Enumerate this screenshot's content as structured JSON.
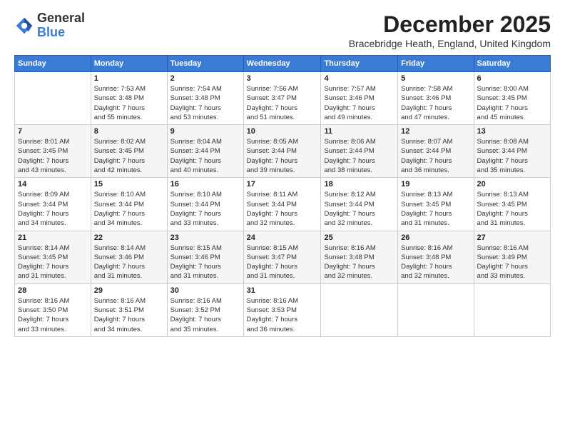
{
  "logo": {
    "general": "General",
    "blue": "Blue"
  },
  "header": {
    "month_title": "December 2025",
    "subtitle": "Bracebridge Heath, England, United Kingdom"
  },
  "days_of_week": [
    "Sunday",
    "Monday",
    "Tuesday",
    "Wednesday",
    "Thursday",
    "Friday",
    "Saturday"
  ],
  "weeks": [
    [
      {
        "day": "",
        "info": ""
      },
      {
        "day": "1",
        "info": "Sunrise: 7:53 AM\nSunset: 3:48 PM\nDaylight: 7 hours\nand 55 minutes."
      },
      {
        "day": "2",
        "info": "Sunrise: 7:54 AM\nSunset: 3:48 PM\nDaylight: 7 hours\nand 53 minutes."
      },
      {
        "day": "3",
        "info": "Sunrise: 7:56 AM\nSunset: 3:47 PM\nDaylight: 7 hours\nand 51 minutes."
      },
      {
        "day": "4",
        "info": "Sunrise: 7:57 AM\nSunset: 3:46 PM\nDaylight: 7 hours\nand 49 minutes."
      },
      {
        "day": "5",
        "info": "Sunrise: 7:58 AM\nSunset: 3:46 PM\nDaylight: 7 hours\nand 47 minutes."
      },
      {
        "day": "6",
        "info": "Sunrise: 8:00 AM\nSunset: 3:45 PM\nDaylight: 7 hours\nand 45 minutes."
      }
    ],
    [
      {
        "day": "7",
        "info": "Sunrise: 8:01 AM\nSunset: 3:45 PM\nDaylight: 7 hours\nand 43 minutes."
      },
      {
        "day": "8",
        "info": "Sunrise: 8:02 AM\nSunset: 3:45 PM\nDaylight: 7 hours\nand 42 minutes."
      },
      {
        "day": "9",
        "info": "Sunrise: 8:04 AM\nSunset: 3:44 PM\nDaylight: 7 hours\nand 40 minutes."
      },
      {
        "day": "10",
        "info": "Sunrise: 8:05 AM\nSunset: 3:44 PM\nDaylight: 7 hours\nand 39 minutes."
      },
      {
        "day": "11",
        "info": "Sunrise: 8:06 AM\nSunset: 3:44 PM\nDaylight: 7 hours\nand 38 minutes."
      },
      {
        "day": "12",
        "info": "Sunrise: 8:07 AM\nSunset: 3:44 PM\nDaylight: 7 hours\nand 36 minutes."
      },
      {
        "day": "13",
        "info": "Sunrise: 8:08 AM\nSunset: 3:44 PM\nDaylight: 7 hours\nand 35 minutes."
      }
    ],
    [
      {
        "day": "14",
        "info": "Sunrise: 8:09 AM\nSunset: 3:44 PM\nDaylight: 7 hours\nand 34 minutes."
      },
      {
        "day": "15",
        "info": "Sunrise: 8:10 AM\nSunset: 3:44 PM\nDaylight: 7 hours\nand 34 minutes."
      },
      {
        "day": "16",
        "info": "Sunrise: 8:10 AM\nSunset: 3:44 PM\nDaylight: 7 hours\nand 33 minutes."
      },
      {
        "day": "17",
        "info": "Sunrise: 8:11 AM\nSunset: 3:44 PM\nDaylight: 7 hours\nand 32 minutes."
      },
      {
        "day": "18",
        "info": "Sunrise: 8:12 AM\nSunset: 3:44 PM\nDaylight: 7 hours\nand 32 minutes."
      },
      {
        "day": "19",
        "info": "Sunrise: 8:13 AM\nSunset: 3:45 PM\nDaylight: 7 hours\nand 31 minutes."
      },
      {
        "day": "20",
        "info": "Sunrise: 8:13 AM\nSunset: 3:45 PM\nDaylight: 7 hours\nand 31 minutes."
      }
    ],
    [
      {
        "day": "21",
        "info": "Sunrise: 8:14 AM\nSunset: 3:45 PM\nDaylight: 7 hours\nand 31 minutes."
      },
      {
        "day": "22",
        "info": "Sunrise: 8:14 AM\nSunset: 3:46 PM\nDaylight: 7 hours\nand 31 minutes."
      },
      {
        "day": "23",
        "info": "Sunrise: 8:15 AM\nSunset: 3:46 PM\nDaylight: 7 hours\nand 31 minutes."
      },
      {
        "day": "24",
        "info": "Sunrise: 8:15 AM\nSunset: 3:47 PM\nDaylight: 7 hours\nand 31 minutes."
      },
      {
        "day": "25",
        "info": "Sunrise: 8:16 AM\nSunset: 3:48 PM\nDaylight: 7 hours\nand 32 minutes."
      },
      {
        "day": "26",
        "info": "Sunrise: 8:16 AM\nSunset: 3:48 PM\nDaylight: 7 hours\nand 32 minutes."
      },
      {
        "day": "27",
        "info": "Sunrise: 8:16 AM\nSunset: 3:49 PM\nDaylight: 7 hours\nand 33 minutes."
      }
    ],
    [
      {
        "day": "28",
        "info": "Sunrise: 8:16 AM\nSunset: 3:50 PM\nDaylight: 7 hours\nand 33 minutes."
      },
      {
        "day": "29",
        "info": "Sunrise: 8:16 AM\nSunset: 3:51 PM\nDaylight: 7 hours\nand 34 minutes."
      },
      {
        "day": "30",
        "info": "Sunrise: 8:16 AM\nSunset: 3:52 PM\nDaylight: 7 hours\nand 35 minutes."
      },
      {
        "day": "31",
        "info": "Sunrise: 8:16 AM\nSunset: 3:53 PM\nDaylight: 7 hours\nand 36 minutes."
      },
      {
        "day": "",
        "info": ""
      },
      {
        "day": "",
        "info": ""
      },
      {
        "day": "",
        "info": ""
      }
    ]
  ]
}
